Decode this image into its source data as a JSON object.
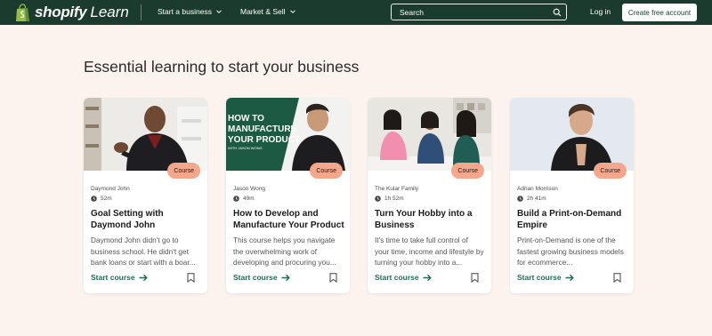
{
  "brand": {
    "name": "shopify",
    "product": "Learn"
  },
  "nav": {
    "items": [
      {
        "label": "Start a business"
      },
      {
        "label": "Market & Sell"
      }
    ],
    "search_placeholder": "Search",
    "login_label": "Log in",
    "create_label": "Create free account"
  },
  "main": {
    "heading": "Essential learning to start your business"
  },
  "cards": [
    {
      "author": "Daymond John",
      "duration": "52m",
      "badge": "Course",
      "title": "Goal Setting with Daymond John",
      "description": "Daymond John didn't go to business school. He didn't get bank loans or start with a boar...",
      "cta": "Start course"
    },
    {
      "author": "Jason Wong",
      "duration": "49m",
      "badge": "Course",
      "title": "How to Develop and Manufacture Your Product",
      "description": "This course helps you navigate the overwhelming work of developing and procuring you...",
      "cta": "Start course",
      "thumb_text": [
        "HOW TO",
        "MANUFACTURE",
        "YOUR PRODUCT",
        "WITH JASON WONG"
      ]
    },
    {
      "author": "The Kular Family",
      "duration": "1h 52m",
      "badge": "Course",
      "title": "Turn Your Hobby into a Business",
      "description": "It's time to take full control of your time, income and lifestyle by turning your hobby into a...",
      "cta": "Start course"
    },
    {
      "author": "Adrian Morrison",
      "duration": "2h 41m",
      "badge": "Course",
      "title": "Build a Print-on-Demand Empire",
      "description": "Print-on-Demand is one of the fastest growing business models for ecommerce...",
      "cta": "Start course"
    }
  ],
  "colors": {
    "header_bg": "#1b3b2f",
    "page_bg": "#fcf3ef",
    "badge": "#f4a78a",
    "cta": "#1f6b4f"
  }
}
